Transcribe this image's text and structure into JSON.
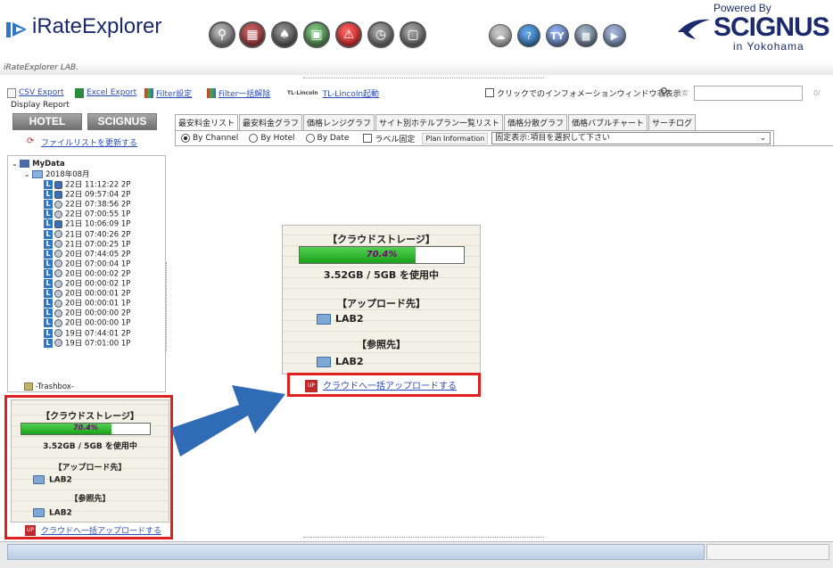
{
  "header": {
    "app_name": "iRateExplorer",
    "powered_by": "Powered By",
    "company": "SCIGNUS",
    "location": "in Yokohama",
    "lab_label": "iRateExplorer LAB.",
    "toolbar_icons": [
      "search-icon",
      "document-icon",
      "cards-icon",
      "windows-icon",
      "warning-icon",
      "clock-icon",
      "chat-icon",
      "cloud-icon",
      "help-icon",
      "ty-icon",
      "monitor-icon",
      "logo-icon"
    ]
  },
  "toolbar": {
    "csv_export": "CSV Export",
    "excel_export": "Excel Export",
    "filter_settings": "Filter設定",
    "filter_clear": "Filter一括解除",
    "tl_lincoln_brand": "TL-Lincoln",
    "tl_lincoln": "TL-Lincoln起動",
    "info_window_toggle": "クリックでのインフォメーションウィンドウ非表示",
    "search_label": "検索",
    "search_value": "",
    "counter": "0/"
  },
  "left_panel": {
    "display_report": "Display Report",
    "hotel_button": "HOTEL",
    "scignus_button": "SCIGNUS",
    "refresh_link": "ファイルリストを更新する",
    "tree": {
      "root": "MyData",
      "month": "2018年08月",
      "items": [
        {
          "label": "22日 11:12:22 2P",
          "icon": "db"
        },
        {
          "label": "22日 09:57:04 2P",
          "icon": "db"
        },
        {
          "label": "22日 07:38:56 2P",
          "icon": "clock"
        },
        {
          "label": "22日 07:00:55 1P",
          "icon": "clock"
        },
        {
          "label": "21日 10:06:09 1P",
          "icon": "db"
        },
        {
          "label": "21日 07:40:26 2P",
          "icon": "clock"
        },
        {
          "label": "21日 07:00:25 1P",
          "icon": "clock"
        },
        {
          "label": "20日 07:44:05 2P",
          "icon": "clock"
        },
        {
          "label": "20日 07:00:04 1P",
          "icon": "clock"
        },
        {
          "label": "20日 00:00:02 2P",
          "icon": "clock"
        },
        {
          "label": "20日 00:00:02 1P",
          "icon": "clock"
        },
        {
          "label": "20日 00:00:01 2P",
          "icon": "clock"
        },
        {
          "label": "20日 00:00:01 1P",
          "icon": "clock"
        },
        {
          "label": "20日 00:00:00 2P",
          "icon": "clock"
        },
        {
          "label": "20日 00:00:00 1P",
          "icon": "clock"
        },
        {
          "label": "19日 07:44:01 2P",
          "icon": "clock"
        },
        {
          "label": "19日 07:01:00 1P",
          "icon": "clock"
        }
      ],
      "trash": "-Trashbox-",
      "leaf_marker": "L"
    }
  },
  "storage": {
    "title": "【クラウドストレージ】",
    "percent_label": "70.4%",
    "used_fraction": 0.704,
    "usage": "3.52GB / 5GB を使用中",
    "upload_title": "【アップロード先】",
    "upload_folder": "LAB2",
    "ref_title": "【参照先】",
    "ref_folder": "LAB2",
    "upload_link": "クラウドへ一括アップロードする",
    "upload_icon_text": "UP"
  },
  "tabs": [
    "最安料金リスト",
    "最安料金グラフ",
    "価格レンジグラフ",
    "サイト別ホテルプラン一覧リスト",
    "価格分散グラフ",
    "価格バブルチャート",
    "サーチログ"
  ],
  "options": {
    "by_channel": "By Channel",
    "by_hotel": "By Hotel",
    "by_date": "By Date",
    "selected": "by_channel",
    "label_fixed": "ラベル固定",
    "plan_info": "Plan Information",
    "select_value": "固定表示:項目を選択して下さい"
  },
  "colors": {
    "highlight": "#e02020",
    "arrow": "#2f6cb5",
    "brand": "#1a2a6c"
  }
}
